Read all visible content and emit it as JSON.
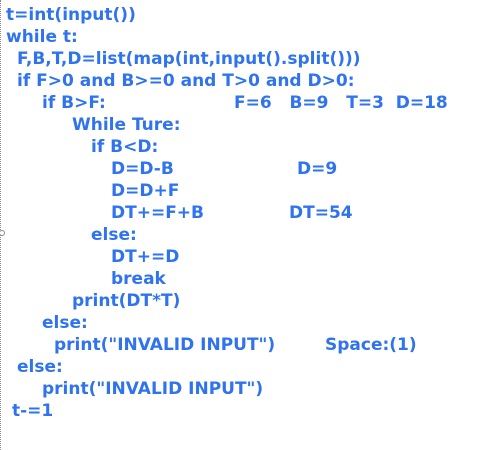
{
  "code": {
    "line_1": "t=int(input())",
    "line_2": "while t:",
    "line_3": "F,B,T,D=list(map(int,input().split()))",
    "line_4": "if F>0 and B>=0 and T>0 and D>0:",
    "line_5": "if B>F:",
    "line_6": "While Ture:",
    "line_7": "if B<D:",
    "line_8": "D=D-B",
    "line_9": "D=D+F",
    "line_10": "DT+=F+B",
    "line_11": "else:",
    "line_12": "DT+=D",
    "line_13": "break",
    "line_14": "print(DT*T)",
    "line_15": "else:",
    "line_16": "print(\"INVALID INPUT\")",
    "line_17": "else:",
    "line_18": "print(\"INVALID INPUT\")",
    "line_19": "t-=1"
  },
  "annotations": {
    "values": "F=6   B=9   T=3  D=18",
    "d_value": "D=9",
    "dt_value": "DT=54",
    "space_note": "Space:(1)"
  },
  "colors": {
    "code_text": "#2f74ee",
    "background": "#ffffff",
    "guide": "#8a8a8a"
  }
}
